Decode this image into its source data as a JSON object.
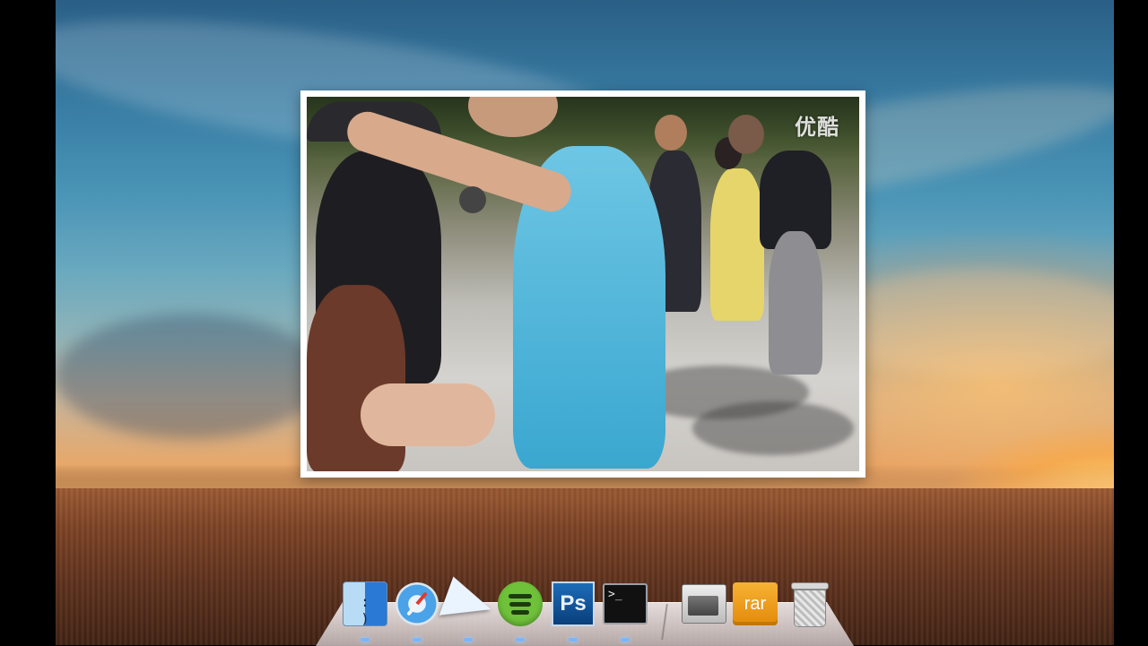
{
  "desktop": {
    "wallpaper": "sky-and-wheat-field-sunset"
  },
  "photo_viewer": {
    "watermark": "优酷",
    "content": "video-frame-street-crowd"
  },
  "dock": {
    "items": [
      {
        "name": "finder",
        "icon": "finder-icon",
        "running": true
      },
      {
        "name": "safari",
        "icon": "safari-icon",
        "running": true
      },
      {
        "name": "mail-sparrow",
        "icon": "paper-plane-icon",
        "running": true
      },
      {
        "name": "spotify",
        "icon": "spotify-icon",
        "running": true
      },
      {
        "name": "photoshop",
        "icon": "photoshop-icon",
        "label": "Ps",
        "running": true
      },
      {
        "name": "terminal",
        "icon": "terminal-icon",
        "label": ">_",
        "running": true
      },
      {
        "name": "image-capture",
        "icon": "scanner-tray-icon",
        "running": false
      },
      {
        "name": "archive",
        "icon": "rar-icon",
        "label": "rar",
        "running": false
      },
      {
        "name": "trash",
        "icon": "trash-icon",
        "running": false
      }
    ],
    "accent": "#7ab6ff"
  }
}
